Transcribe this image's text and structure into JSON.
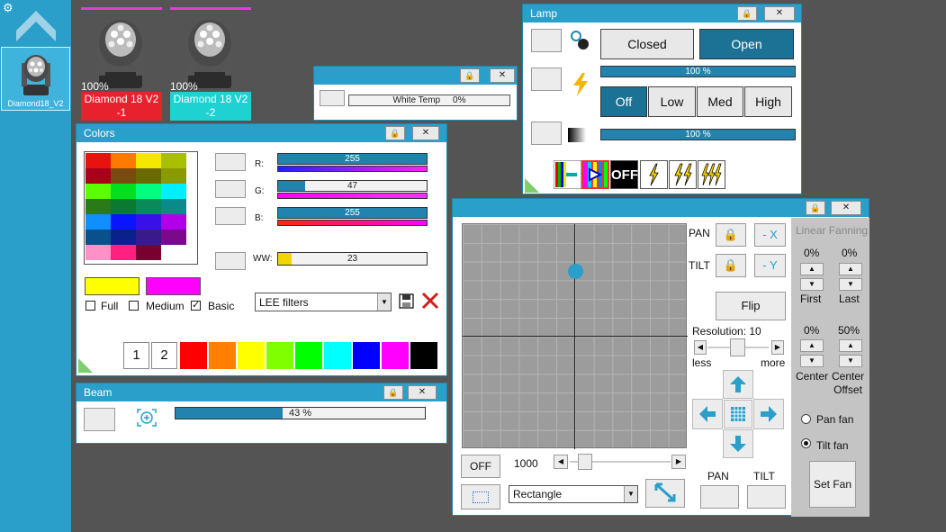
{
  "sidebar": {
    "fixture_label": "Diamond18_V2"
  },
  "fixtures": [
    {
      "percent": "100%",
      "name": "Diamond 18 V2",
      "index": "-1",
      "color": "#e8212e"
    },
    {
      "percent": "100%",
      "name": "Diamond 18 V2",
      "index": "-2",
      "color": "#1fd2d2"
    }
  ],
  "close_glyph": "✕",
  "lock_glyph": "🔒",
  "white_temp": {
    "label": "White Temp",
    "value": "0%"
  },
  "lamp": {
    "title": "Lamp",
    "closed_label": "Closed",
    "open_label": "Open",
    "bar1_text": "100 %",
    "bar1_fill": 1.0,
    "off_label": "Off",
    "low_label": "Low",
    "med_label": "Med",
    "high_label": "High",
    "bar2_text": "100 %",
    "bar2_fill": 1.0,
    "strobe_off_label": "OFF"
  },
  "colors": {
    "title": "Colors",
    "r_label": "R:",
    "g_label": "G:",
    "b_label": "B:",
    "ww_label": "WW:",
    "r_value": "255",
    "g_value": "47",
    "b_value": "255",
    "ww_value": "23",
    "r_fill": 1.0,
    "g_fill": 0.18,
    "b_fill": 1.0,
    "ww_fill": 0.09,
    "full_label": "Full",
    "medium_label": "Medium",
    "basic_label": "Basic",
    "filter_select": "LEE filters",
    "preset1": "1",
    "preset2": "2",
    "swatch_a": "#ffff00",
    "swatch_b": "#ff00ff",
    "palette": [
      "#ff0000",
      "#ff8000",
      "#ffff00",
      "#80ff00",
      "#00ff00",
      "#00ffff",
      "#0000ff",
      "#ff00ff",
      "#000000"
    ]
  },
  "beam": {
    "title": "Beam",
    "zoom_text": "43 %",
    "zoom_fill": 0.43
  },
  "pantilt": {
    "pan_label": "PAN",
    "tilt_label": "TILT",
    "minus_x": "- X",
    "minus_y": "- Y",
    "flip_label": "Flip",
    "resolution_label": "Resolution: 10",
    "less_label": "less",
    "more_label": "more",
    "off_label": "OFF",
    "speed_value": "1000",
    "shape_select": "Rectangle",
    "pan_bottom_label": "PAN",
    "tilt_bottom_label": "TILT",
    "fanning_title": "Linear Fanning",
    "first_value": "0%",
    "last_value": "0%",
    "first_label": "First",
    "last_label": "Last",
    "center_value": "0%",
    "offset_value": "50%",
    "center_label": "Center",
    "center_offset_label": "Center\nOffset",
    "pan_fan_label": "Pan fan",
    "tilt_fan_label": "Tilt fan",
    "set_fan_label": "Set Fan",
    "dot_x": 0.5,
    "dot_y": 0.21
  }
}
